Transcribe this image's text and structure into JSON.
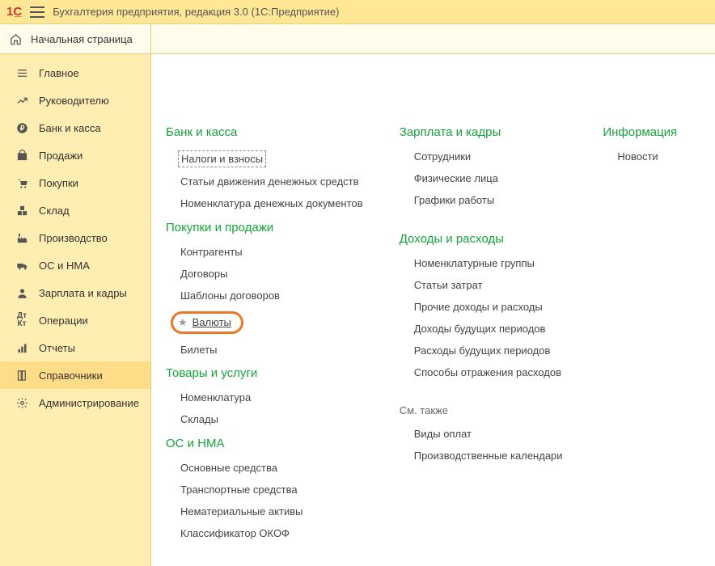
{
  "app_title": "Бухгалтерия предприятия, редакция 3.0  (1С:Предприятие)",
  "start_page_label": "Начальная страница",
  "sidebar": {
    "items": [
      {
        "label": "Главное",
        "icon": "menu-icon"
      },
      {
        "label": "Руководителю",
        "icon": "chart-icon"
      },
      {
        "label": "Банк и касса",
        "icon": "ruble-icon"
      },
      {
        "label": "Продажи",
        "icon": "bag-icon"
      },
      {
        "label": "Покупки",
        "icon": "cart-icon"
      },
      {
        "label": "Склад",
        "icon": "boxes-icon"
      },
      {
        "label": "Производство",
        "icon": "factory-icon"
      },
      {
        "label": "ОС и НМА",
        "icon": "truck-icon"
      },
      {
        "label": "Зарплата и кадры",
        "icon": "person-icon"
      },
      {
        "label": "Операции",
        "icon": "operations-icon"
      },
      {
        "label": "Отчеты",
        "icon": "reports-icon"
      },
      {
        "label": "Справочники",
        "icon": "books-icon",
        "active": true
      },
      {
        "label": "Администрирование",
        "icon": "gear-icon"
      }
    ]
  },
  "columns": {
    "col1": [
      {
        "header": "Банк и касса",
        "items": [
          {
            "label": "Налоги и взносы",
            "dotted": true
          },
          {
            "label": "Статьи движения денежных средств"
          },
          {
            "label": "Номенклатура денежных документов"
          }
        ]
      },
      {
        "header": "Покупки и продажи",
        "items": [
          {
            "label": "Контрагенты"
          },
          {
            "label": "Договоры"
          },
          {
            "label": "Шаблоны договоров"
          },
          {
            "label": "Валюты",
            "highlighted": true
          },
          {
            "label": "Билеты"
          }
        ]
      },
      {
        "header": "Товары и услуги",
        "items": [
          {
            "label": "Номенклатура"
          },
          {
            "label": "Склады"
          }
        ]
      },
      {
        "header": "ОС и НМА",
        "items": [
          {
            "label": "Основные средства"
          },
          {
            "label": "Транспортные средства"
          },
          {
            "label": "Нематериальные активы"
          },
          {
            "label": "Классификатор ОКОФ"
          }
        ]
      }
    ],
    "col2": [
      {
        "header": "Зарплата и кадры",
        "items": [
          {
            "label": "Сотрудники"
          },
          {
            "label": "Физические лица"
          },
          {
            "label": "Графики работы"
          }
        ]
      },
      {
        "header": "Доходы и расходы",
        "items": [
          {
            "label": "Номенклатурные группы"
          },
          {
            "label": "Статьи затрат"
          },
          {
            "label": "Прочие доходы и расходы"
          },
          {
            "label": "Доходы будущих периодов"
          },
          {
            "label": "Расходы будущих периодов"
          },
          {
            "label": "Способы отражения расходов"
          }
        ]
      },
      {
        "see_also": "См. также",
        "items": [
          {
            "label": "Виды оплат"
          },
          {
            "label": "Производственные календари"
          }
        ]
      }
    ],
    "col3": [
      {
        "header": "Информация",
        "items": [
          {
            "label": "Новости"
          }
        ]
      }
    ]
  }
}
